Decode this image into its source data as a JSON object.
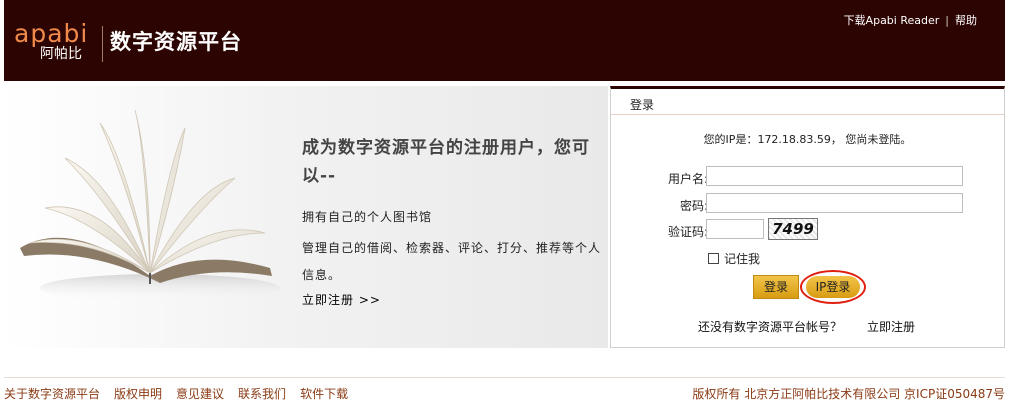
{
  "header": {
    "logo_latin": "apabi",
    "logo_cn": "阿帕比",
    "platform_name": "数字资源平台",
    "links": [
      "下载Apabi Reader",
      "帮助"
    ]
  },
  "promo": {
    "title": "成为数字资源平台的注册用户，您可以--",
    "line1": "拥有自己的个人图书馆",
    "line2": "管理自己的借阅、检索器、评论、打分、推荐等个人信息。",
    "register_link": "立即注册 >>"
  },
  "login": {
    "title": "登录",
    "ip_status": "您的IP是：172.18.83.59， 您尚未登陆。",
    "username_label": "用户名:",
    "password_label": "密码:",
    "captcha_label": "验证码:",
    "captcha_text": "7499",
    "remember_label": "记住我",
    "login_button": "登录",
    "ip_login_button": "IP登录",
    "no_account_text": "还没有数字资源平台帐号？",
    "register_now": "立即注册"
  },
  "footer": {
    "links": [
      "关于数字资源平台",
      "版权申明",
      "意见建议",
      "联系我们",
      "软件下载"
    ],
    "copyright": "版权所有 北京方正阿帕比技术有限公司 京ICP证050487号"
  },
  "colors": {
    "header_bg": "#2c0402",
    "button_gold": "#e0a821",
    "highlight_ring": "#e02010",
    "footer_link": "#8a3a14"
  }
}
